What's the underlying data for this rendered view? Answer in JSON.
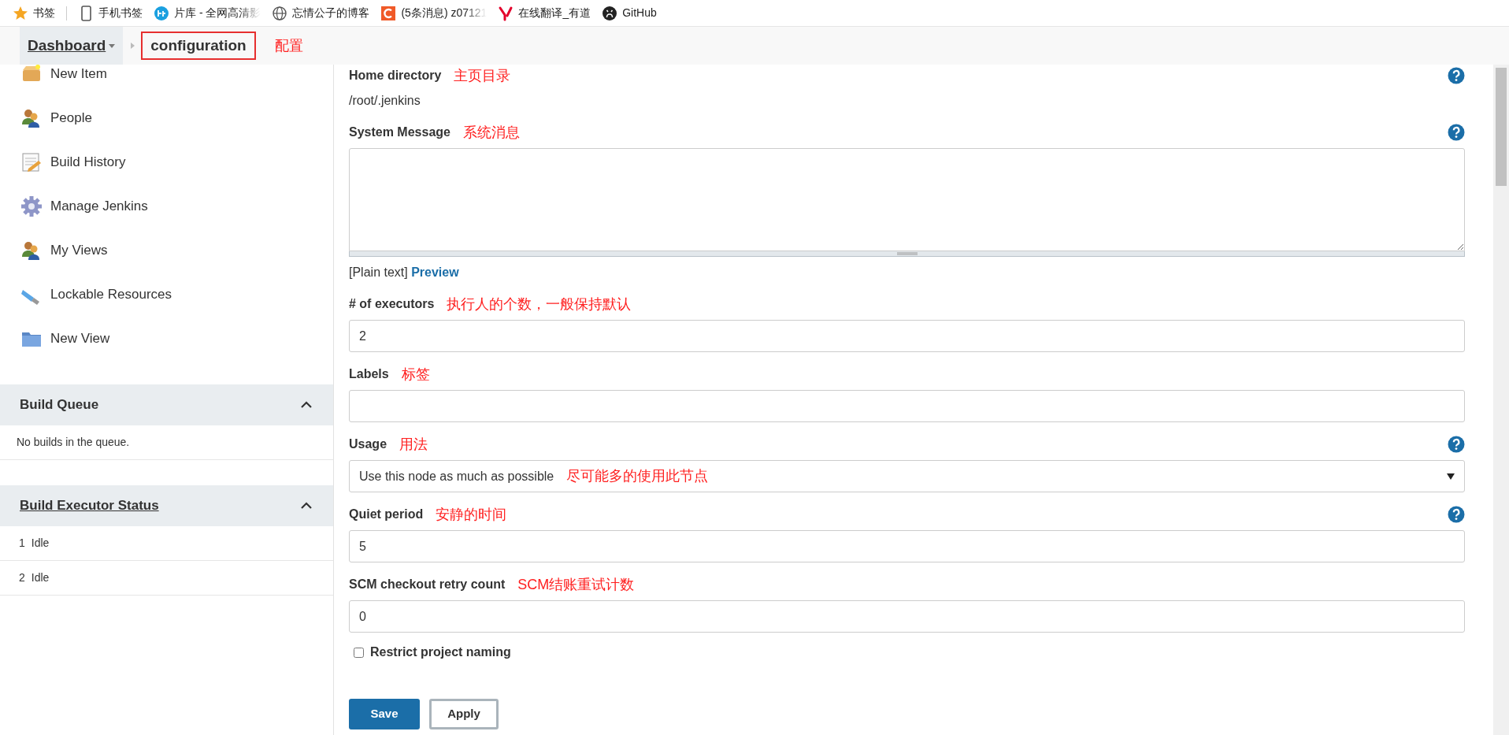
{
  "bookmarks": [
    {
      "label": "书签"
    },
    {
      "label": "手机书签"
    },
    {
      "label": "片库 - 全网高清影",
      "faded": true
    },
    {
      "label": "忘情公子的博客"
    },
    {
      "label": "(5条消息) z07121",
      "faded": true
    },
    {
      "label": "在线翻译_有道"
    },
    {
      "label": "GitHub"
    }
  ],
  "breadcrumb": {
    "items": [
      {
        "label": "Dashboard",
        "dropdown": true,
        "highlighted": false
      },
      {
        "label": "configuration",
        "dropdown": false,
        "highlighted": true
      }
    ],
    "annotation": "配置"
  },
  "sidebar": {
    "items": [
      {
        "label": "New Item"
      },
      {
        "label": "People"
      },
      {
        "label": "Build History"
      },
      {
        "label": "Manage Jenkins"
      },
      {
        "label": "My Views"
      },
      {
        "label": "Lockable Resources"
      },
      {
        "label": "New View"
      }
    ],
    "panels": [
      {
        "title": "Build Queue",
        "link": false,
        "expanded": true,
        "empty_text": "No builds in the queue."
      },
      {
        "title": "Build Executor Status",
        "link": true,
        "expanded": true,
        "rows": [
          {
            "number": "1",
            "status": "Idle"
          },
          {
            "number": "2",
            "status": "Idle"
          }
        ]
      }
    ]
  },
  "form": {
    "fields": [
      {
        "kind": "text",
        "label": "Home directory",
        "annotation": "主页目录",
        "help": true,
        "value": "/root/.jenkins"
      },
      {
        "kind": "textarea",
        "label": "System Message",
        "annotation": "系统消息",
        "help": true,
        "format": "[Plain text]",
        "preview": "Preview"
      },
      {
        "kind": "input",
        "label": "# of executors",
        "annotation": "执行人的个数，一般保持默认",
        "help": false,
        "value": "2"
      },
      {
        "kind": "input",
        "label": "Labels",
        "annotation": "标签",
        "help": false
      },
      {
        "kind": "select",
        "label": "Usage",
        "annotation": "用法",
        "help": true,
        "value": "Use this node as much as possible",
        "value_annotation": "尽可能多的使用此节点"
      },
      {
        "kind": "input",
        "label": "Quiet period",
        "annotation": "安静的时间",
        "help": true,
        "value": "5"
      },
      {
        "kind": "input",
        "label": "SCM checkout retry count",
        "annotation": "SCM结账重试计数",
        "help": false,
        "value": "0"
      },
      {
        "kind": "checkbox",
        "label": "Restrict project naming",
        "checked": false
      }
    ],
    "buttons": [
      {
        "label": "Save",
        "primary": true
      },
      {
        "label": "Apply",
        "primary": false
      }
    ]
  }
}
